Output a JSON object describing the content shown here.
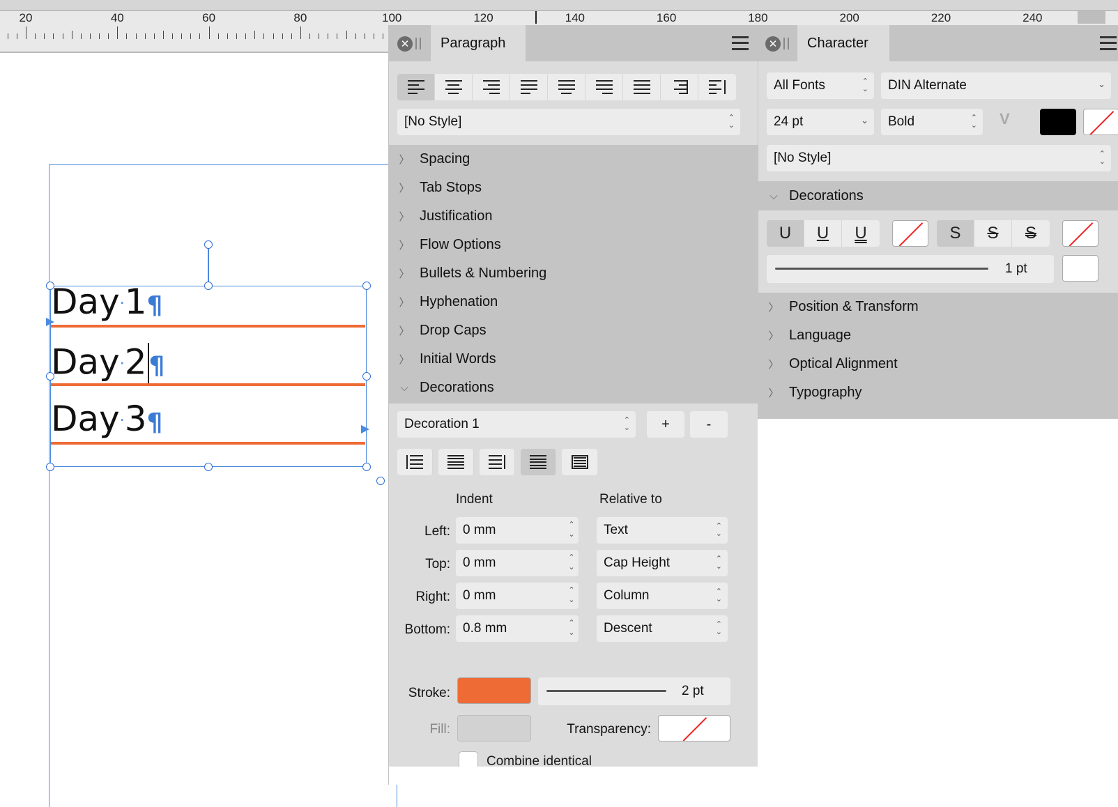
{
  "ruler": {
    "labels": [
      "20",
      "40",
      "60",
      "80",
      "100",
      "120",
      "140",
      "160",
      "180",
      "200",
      "220",
      "240"
    ]
  },
  "canvas": {
    "lines": [
      "Day",
      "1",
      "Day",
      "2",
      "Day",
      "3"
    ],
    "underline_color": "#ee6b35"
  },
  "paragraph": {
    "tab_label": "Paragraph",
    "style_value": "[No Style]",
    "sections": [
      "Spacing",
      "Tab Stops",
      "Justification",
      "Flow Options",
      "Bullets & Numbering",
      "Hyphenation",
      "Drop Caps",
      "Initial Words",
      "Decorations"
    ],
    "decoration_select": "Decoration 1",
    "add_label": "+",
    "remove_label": "-",
    "indent_header": "Indent",
    "relative_header": "Relative to",
    "rows": [
      {
        "label": "Left:",
        "value": "0 mm",
        "relative": "Text"
      },
      {
        "label": "Top:",
        "value": "0 mm",
        "relative": "Cap Height"
      },
      {
        "label": "Right:",
        "value": "0 mm",
        "relative": "Column"
      },
      {
        "label": "Bottom:",
        "value": "0.8 mm",
        "relative": "Descent"
      }
    ],
    "stroke_label": "Stroke:",
    "stroke_color": "#ee6b35",
    "stroke_width": "2 pt",
    "fill_label": "Fill:",
    "transparency_label": "Transparency:",
    "combine_label": "Combine identical"
  },
  "character": {
    "tab_label": "Character",
    "font_collection": "All Fonts",
    "font_family": "DIN Alternate",
    "font_size": "24 pt",
    "font_weight": "Bold",
    "style_value": "[No Style]",
    "decorations_label": "Decorations",
    "underline_labels": [
      "U",
      "U",
      "U"
    ],
    "strike_labels": [
      "S",
      "S",
      "S"
    ],
    "line_weight": "1 pt",
    "sections": [
      "Position & Transform",
      "Language",
      "Optical Alignment",
      "Typography"
    ]
  }
}
